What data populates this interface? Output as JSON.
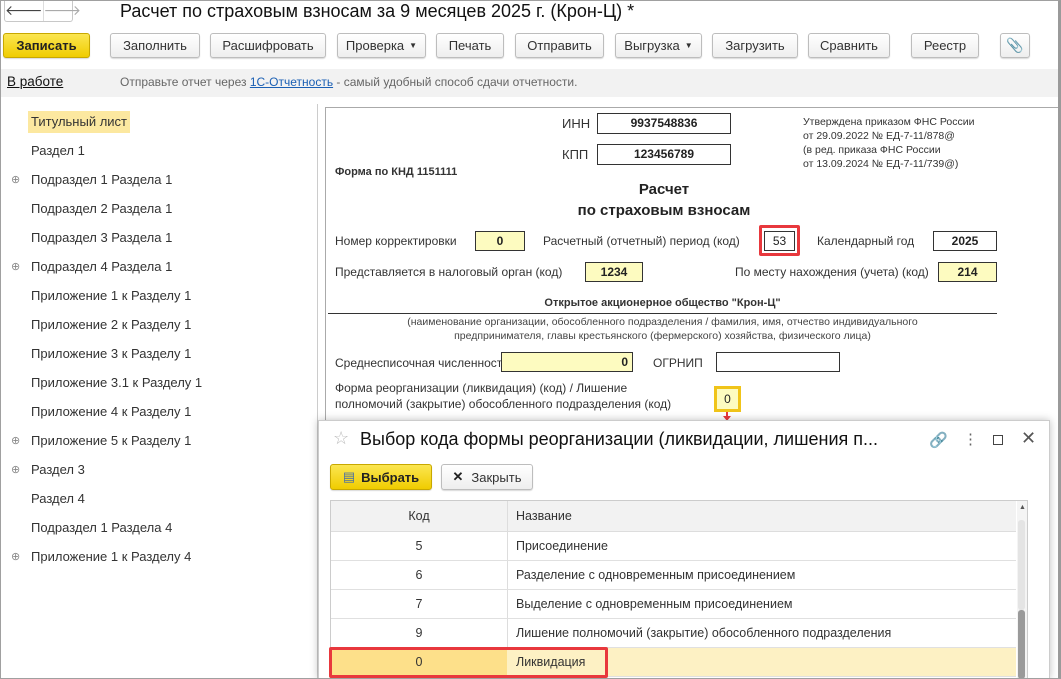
{
  "window": {
    "title": "Расчет по страховым взносам за 9 месяцев 2025 г. (Крон-Ц) *",
    "back": "🡐",
    "forward": "🡒"
  },
  "toolbar": {
    "save": "Записать",
    "fill": "Заполнить",
    "decode": "Расшифровать",
    "check": "Проверка",
    "print": "Печать",
    "send": "Отправить",
    "export": "Выгрузка",
    "load": "Загрузить",
    "compare": "Сравнить",
    "registry": "Реестр"
  },
  "status": {
    "state": "В работе",
    "hint_before": "Отправьте отчет через ",
    "hint_link": "1С-Отчетность",
    "hint_after": " - самый удобный способ сдачи отчетности."
  },
  "sidebar": {
    "items": [
      {
        "label": "Титульный лист",
        "active": true,
        "expandable": false
      },
      {
        "label": "Раздел 1",
        "expandable": false
      },
      {
        "label": "Подраздел 1 Раздела 1",
        "expandable": true
      },
      {
        "label": "Подраздел 2 Раздела 1",
        "expandable": false
      },
      {
        "label": "Подраздел 3 Раздела 1",
        "expandable": false
      },
      {
        "label": "Подраздел 4 Раздела 1",
        "expandable": true
      },
      {
        "label": "Приложение 1 к Разделу 1",
        "expandable": false
      },
      {
        "label": "Приложение 2 к Разделу 1",
        "expandable": false
      },
      {
        "label": "Приложение 3 к Разделу 1",
        "expandable": false
      },
      {
        "label": "Приложение 3.1 к Разделу 1",
        "expandable": false
      },
      {
        "label": "Приложение 4 к Разделу 1",
        "expandable": false
      },
      {
        "label": "Приложение 5 к Разделу 1",
        "expandable": true
      },
      {
        "label": "Раздел 3",
        "expandable": true
      },
      {
        "label": "Раздел 4",
        "expandable": false
      },
      {
        "label": "Подраздел 1 Раздела 4",
        "expandable": false
      },
      {
        "label": "Приложение 1 к Разделу 4",
        "expandable": true
      }
    ]
  },
  "form": {
    "inn_label": "ИНН",
    "inn": "9937548836",
    "kpp_label": "КПП",
    "kpp": "123456789",
    "approved": [
      "Утверждена приказом ФНС России",
      "от 29.09.2022 № ЕД-7-11/878@",
      "(в ред. приказа ФНС России",
      "от 13.09.2024 № ЕД-7-11/739@)"
    ],
    "knd": "Форма по КНД 1151111",
    "heading1": "Расчет",
    "heading2": "по страховым взносам",
    "correction_label": "Номер корректировки",
    "correction": "0",
    "period_label": "Расчетный (отчетный) период (код)",
    "period": "53",
    "year_label": "Календарный год",
    "year": "2025",
    "tax_office_label": "Представляется в налоговый орган (код)",
    "tax_office": "1234",
    "location_label": "По месту нахождения (учета) (код)",
    "location": "214",
    "org_name": "Открытое акционерное общество \"Крон-Ц\"",
    "org_caption1": "(наименование организации, обособленного подразделения / фамилия, имя, отчество индивидуального",
    "org_caption2": "предпринимателя, главы крестьянского (фермерского) хозяйства, физического лица)",
    "headcount_label": "Среднесписочная численность (чел.)",
    "headcount": "0",
    "ogrnip_label": "ОГРНИП",
    "ogrnip": "",
    "reorg_label1": "Форма реорганизации (ликвидация) (код) / Лишение",
    "reorg_label2": "полномочий (закрытие) обособленного подразделения (код)",
    "reorg": "0"
  },
  "dialog": {
    "title": "Выбор кода формы реорганизации (ликвидации, лишения п...",
    "select": "Выбрать",
    "close": "Закрыть",
    "columns": [
      "Код",
      "Название"
    ],
    "rows": [
      {
        "code": "5",
        "name": "Присоединение"
      },
      {
        "code": "6",
        "name": "Разделение с одновременным присоединением"
      },
      {
        "code": "7",
        "name": "Выделение с одновременным присоединением"
      },
      {
        "code": "9",
        "name": "Лишение полномочий (закрытие) обособленного подразделения"
      },
      {
        "code": "0",
        "name": "Ликвидация",
        "selected": true
      }
    ]
  },
  "colors": {
    "accent": "#f5d000",
    "highlight": "#e8383d",
    "selection": "#fdf1c4"
  }
}
